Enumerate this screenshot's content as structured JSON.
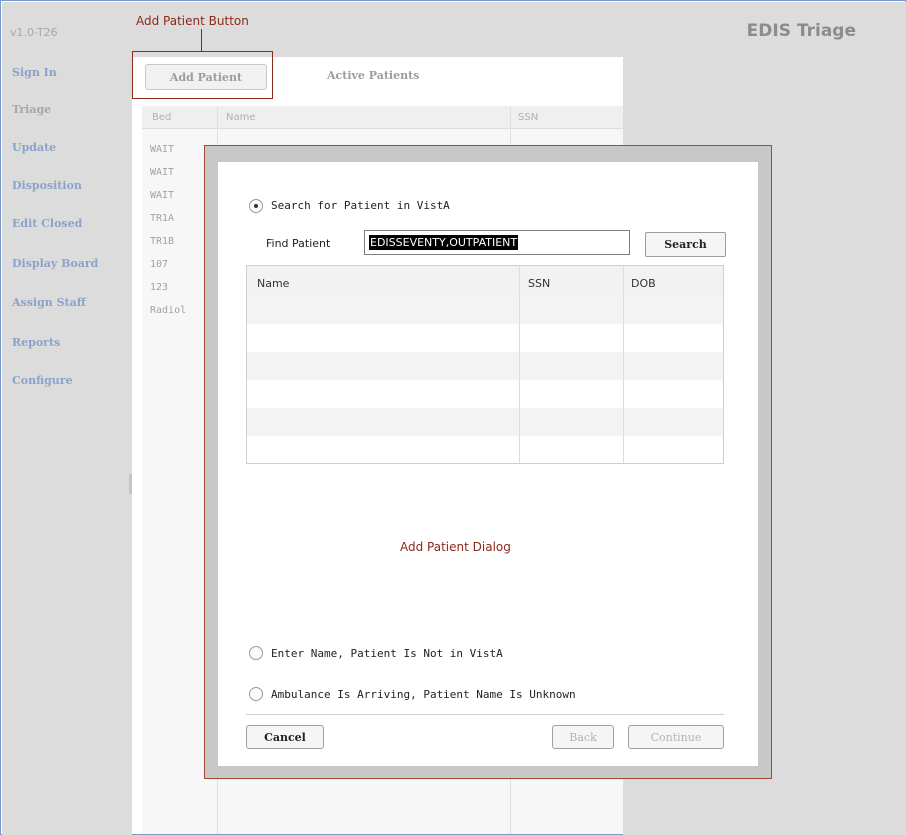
{
  "header": {
    "version": "v1.0-T26",
    "app_title": "EDIS Triage"
  },
  "sidebar": {
    "items": [
      {
        "label": "Sign In",
        "muted": false
      },
      {
        "label": "Triage",
        "muted": true
      },
      {
        "label": "Update",
        "muted": false
      },
      {
        "label": "Disposition",
        "muted": false
      },
      {
        "label": "Edit Closed",
        "muted": false
      },
      {
        "label": "Display Board",
        "muted": false
      },
      {
        "label": "Assign Staff",
        "muted": false
      },
      {
        "label": "Reports",
        "muted": false
      },
      {
        "label": "Configure",
        "muted": false
      }
    ]
  },
  "toolbar": {
    "add_patient_label": "Add Patient",
    "active_patients_label": "Active Patients"
  },
  "annotations": {
    "button_callout": "Add Patient Button",
    "dialog_caption": "Add Patient Dialog"
  },
  "background_table": {
    "columns": [
      "Bed",
      "Name",
      "SSN"
    ],
    "beds": [
      "WAIT",
      "WAIT",
      "WAIT",
      "TR1A",
      "TR1B",
      "107",
      "123",
      "Radiol"
    ]
  },
  "dialog": {
    "option_search_label": "Search for Patient in VistA",
    "find_label": "Find Patient",
    "find_value": "EDISSEVENTY,OUTPATIENT",
    "search_button": "Search",
    "results_columns": [
      "Name",
      "SSN",
      "DOB"
    ],
    "option_enter_name_label": "Enter Name, Patient Is Not in VistA",
    "option_ambulance_label": "Ambulance Is Arriving, Patient Name Is Unknown",
    "cancel_button": "Cancel",
    "back_button": "Back",
    "continue_button": "Continue"
  },
  "colors": {
    "annotation": "#8b2a1a",
    "nav_link": "#8aa3c8",
    "panel_grey": "#dcdcdc"
  },
  "icons": [
    "radio-selected-icon",
    "radio-unselected-icon"
  ]
}
